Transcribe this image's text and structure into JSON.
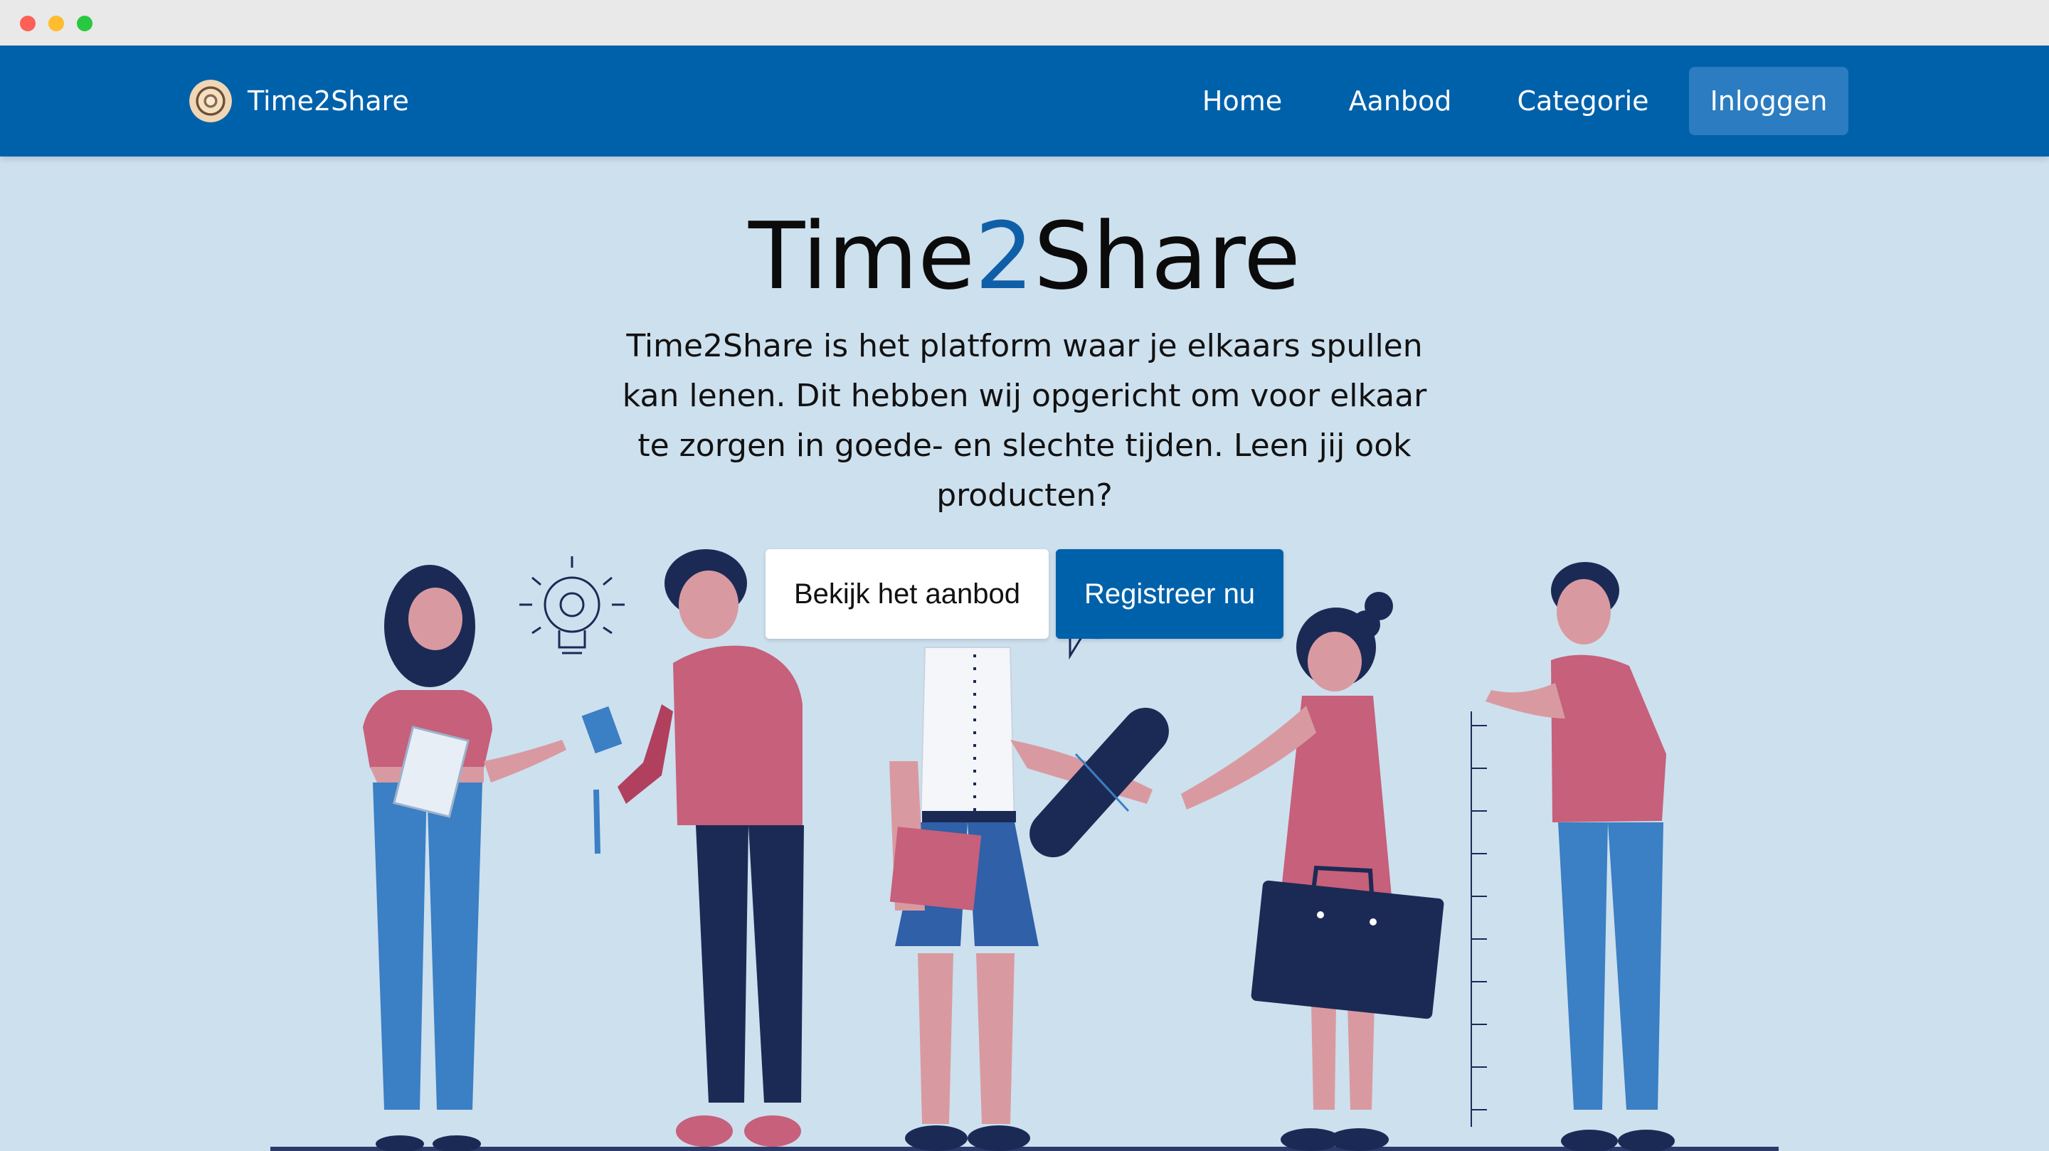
{
  "brand": {
    "name": "Time2Share",
    "logo_icon": "spiral-shell-icon"
  },
  "nav": {
    "items": [
      {
        "label": "Home"
      },
      {
        "label": "Aanbod"
      },
      {
        "label": "Categorie"
      },
      {
        "label": "Inloggen"
      }
    ]
  },
  "hero": {
    "title_start": "Time",
    "title_accent": "2",
    "title_end": "Share",
    "description": "Time2Share is het platform waar je elkaars spullen kan lenen. Dit hebben wij opgericht om voor elkaar te zorgen in goede- en slechte tijden. Leen jij ook producten?",
    "button_offer": "Bekijk het aanbod",
    "button_register": "Registreer nu"
  },
  "colors": {
    "navbar": "#0061ab",
    "background": "#cde0ee",
    "accent": "#0f5ea8",
    "login_button": "#2b7cc0"
  }
}
